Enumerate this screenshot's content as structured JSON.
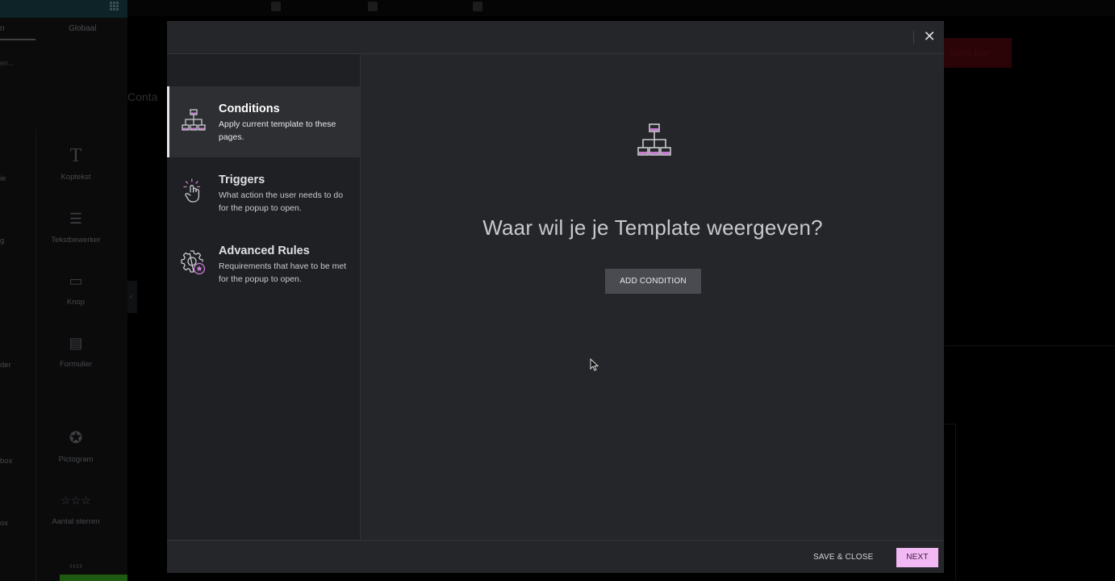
{
  "background": {
    "tabs": [
      "n",
      "Globaal"
    ],
    "search_placeholder": "en...",
    "widgets": [
      {
        "label": "Koptekst",
        "icon": "heading-icon"
      },
      {
        "label": "Tekstbewerker",
        "icon": "text-editor-icon"
      },
      {
        "label": "Knop",
        "icon": "button-icon"
      },
      {
        "label": "Formulier",
        "icon": "form-icon"
      },
      {
        "label": "Pictogram",
        "icon": "star-circle-icon"
      },
      {
        "label": "Aantal sterren",
        "icon": "star-rating-icon"
      }
    ],
    "partial_labels": [
      "ie",
      "g",
      "der",
      "box",
      "ox"
    ],
    "contact_text": "Conta",
    "cta_button": "Start live"
  },
  "modal": {
    "close_icon": "close-icon",
    "nav": [
      {
        "title": "Conditions",
        "description": "Apply current template to these pages.",
        "icon": "sitemap-icon",
        "active": true
      },
      {
        "title": "Triggers",
        "description": "What action the user needs to do for the popup to open.",
        "icon": "hand-click-icon",
        "active": false
      },
      {
        "title": "Advanced Rules",
        "description": "Requirements that have to be met for the popup to open.",
        "icon": "gear-star-icon",
        "active": false
      }
    ],
    "content": {
      "icon": "sitemap-icon",
      "headline": "Waar wil je je Template weergeven?",
      "add_button": "ADD CONDITION"
    },
    "footer": {
      "save_close": "SAVE & CLOSE",
      "next": "NEXT"
    }
  },
  "colors": {
    "accent_pink": "#f2b8f4",
    "icon_purple": "#c77bd1",
    "modal_bg": "#25262a",
    "sidebar_bg": "#1f2023"
  }
}
